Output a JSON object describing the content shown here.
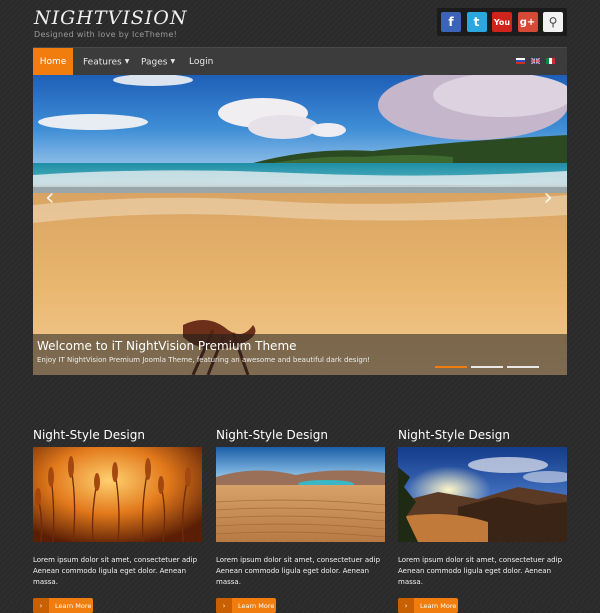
{
  "site": {
    "title": "NIGHTVISION",
    "tagline": "Designed with love by IceTheme!"
  },
  "social": [
    {
      "name": "facebook-icon",
      "glyph": "f",
      "color": "#3b64b8"
    },
    {
      "name": "twitter-icon",
      "glyph": "t",
      "color": "#2aa7e0"
    },
    {
      "name": "youtube-icon",
      "glyph": "You",
      "color": "#d0231c"
    },
    {
      "name": "google-plus-icon",
      "glyph": "g+",
      "color": "#d64937"
    },
    {
      "name": "search-icon",
      "glyph": "⚲",
      "color": "#f2f2f2"
    }
  ],
  "nav": {
    "home": "Home",
    "features": "Features",
    "pages": "Pages",
    "login": "Login"
  },
  "languages": [
    "russian-flag-icon",
    "english-flag-icon",
    "italian-flag-icon"
  ],
  "slider": {
    "caption_title": "Welcome to iT NightVision Premium Theme",
    "caption_text": "Enjoy IT NightVision Premium Joomla Theme, featuring an awesome and beautiful dark design!",
    "prev_icon": "‹",
    "next_icon": "›",
    "active_slide": 1,
    "slide_count": 3
  },
  "features": [
    {
      "title": "Night-Style Design",
      "text": "Lorem ipsum dolor sit amet, consectetuer adip Aenean commodo ligula eget dolor. Aenean massa.",
      "button": "Learn More"
    },
    {
      "title": "Night-Style Design",
      "text": "Lorem ipsum dolor sit amet, consectetuer adip Aenean commodo ligula eget dolor. Aenean massa.",
      "button": "Learn More"
    },
    {
      "title": "Night-Style Design",
      "text": "Lorem ipsum dolor sit amet, consectetuer adip Aenean commodo ligula eget dolor. Aenean massa.",
      "button": "Learn More"
    }
  ],
  "colors": {
    "accent": "#f07d0e",
    "nav_bg": "#3c3c3c",
    "page_bg": "#2b2b2b"
  }
}
